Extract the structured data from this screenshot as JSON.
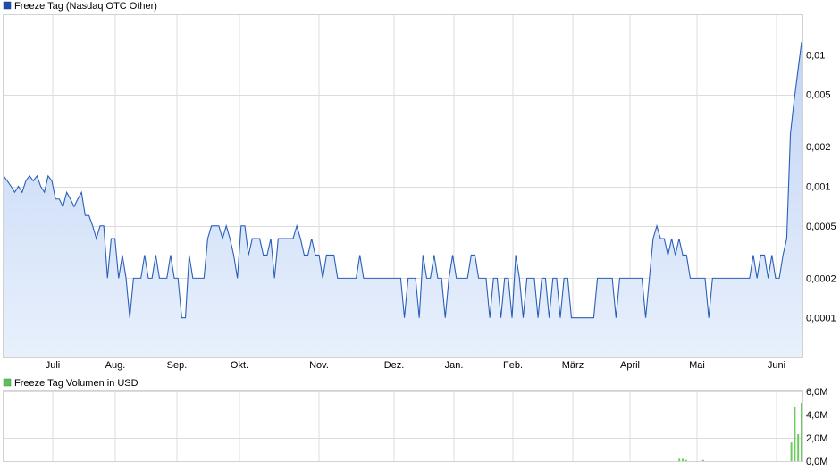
{
  "price_panel": {
    "legend": "Freeze Tag (Nasdaq OTC Other)",
    "legend_color": "#1f4ea8",
    "line_color": "#2a5fb8",
    "fill_top": "#c2d5f5",
    "fill_bottom": "#e8f0fc"
  },
  "volume_panel": {
    "legend": "Freeze Tag Volumen in USD",
    "legend_color": "#5bbf5b",
    "bar_color": "#6dcc5f"
  },
  "chart_data": [
    {
      "type": "area",
      "title": "Freeze Tag (Nasdaq OTC Other)",
      "y_scale": "log",
      "grid": true,
      "x_tick_labels": [
        "Juli",
        "Aug.",
        "Sep.",
        "Okt.",
        "Nov.",
        "Dez.",
        "Jan.",
        "Feb.",
        "März",
        "April",
        "Mai",
        "Juni"
      ],
      "y_ticks": [
        0.0001,
        0.0002,
        0.0005,
        0.001,
        0.002,
        0.005,
        0.01
      ],
      "y_tick_labels": [
        "0,0001",
        "0,0002",
        "0,0005",
        "0,001",
        "0,002",
        "0,005",
        "0,01"
      ],
      "ylim": [
        5e-05,
        0.02
      ],
      "series": [
        {
          "values": [
            0.0012,
            0.0011,
            0.001,
            0.0009,
            0.001,
            0.0009,
            0.0011,
            0.0012,
            0.0011,
            0.0012,
            0.001,
            0.0009,
            0.0012,
            0.0011,
            0.0008,
            0.0008,
            0.0007,
            0.0009,
            0.0008,
            0.0007,
            0.0008,
            0.0009,
            0.0006,
            0.0006,
            0.0005,
            0.0004,
            0.0005,
            0.0005,
            0.0002,
            0.0004,
            0.0004,
            0.0002,
            0.0003,
            0.0002,
            0.0001,
            0.0002,
            0.0002,
            0.0002,
            0.0003,
            0.0002,
            0.0002,
            0.0003,
            0.0002,
            0.0002,
            0.0002,
            0.0003,
            0.0002,
            0.0002,
            0.0001,
            0.0001,
            0.0003,
            0.0002,
            0.0002,
            0.0002,
            0.0002,
            0.0004,
            0.0005,
            0.0005,
            0.0005,
            0.0004,
            0.0005,
            0.0004,
            0.0003,
            0.0002,
            0.0005,
            0.0005,
            0.0003,
            0.0004,
            0.0004,
            0.0004,
            0.0003,
            0.0003,
            0.0004,
            0.0002,
            0.0004,
            0.0004,
            0.0004,
            0.0004,
            0.0004,
            0.0005,
            0.0004,
            0.0003,
            0.0003,
            0.0004,
            0.0003,
            0.0003,
            0.0002,
            0.0003,
            0.0003,
            0.0003,
            0.0002,
            0.0002,
            0.0002,
            0.0002,
            0.0002,
            0.0002,
            0.0003,
            0.0002,
            0.0002,
            0.0002,
            0.0002,
            0.0002,
            0.0002,
            0.0002,
            0.0002,
            0.0002,
            0.0002,
            0.0002,
            0.0001,
            0.0002,
            0.0002,
            0.0002,
            0.0001,
            0.0003,
            0.0002,
            0.0002,
            0.0003,
            0.0002,
            0.0002,
            0.0001,
            0.0002,
            0.0003,
            0.0002,
            0.0002,
            0.0002,
            0.0002,
            0.0003,
            0.0003,
            0.0002,
            0.0002,
            0.0002,
            0.0001,
            0.0002,
            0.0002,
            0.0001,
            0.0002,
            0.0002,
            0.0001,
            0.0003,
            0.0002,
            0.0001,
            0.0002,
            0.0002,
            0.0002,
            0.0001,
            0.0002,
            0.0002,
            0.0001,
            0.0002,
            0.0002,
            0.0001,
            0.0002,
            0.0002,
            0.0001,
            0.0001,
            0.0001,
            0.0001,
            0.0001,
            0.0001,
            0.0001,
            0.0002,
            0.0002,
            0.0002,
            0.0002,
            0.0002,
            0.0001,
            0.0002,
            0.0002,
            0.0002,
            0.0002,
            0.0002,
            0.0002,
            0.0002,
            0.0001,
            0.0002,
            0.0004,
            0.0005,
            0.0004,
            0.0004,
            0.0003,
            0.0004,
            0.0003,
            0.0004,
            0.0003,
            0.0003,
            0.0002,
            0.0002,
            0.0002,
            0.0002,
            0.0002,
            0.0001,
            0.0002,
            0.0002,
            0.0002,
            0.0002,
            0.0002,
            0.0002,
            0.0002,
            0.0002,
            0.0002,
            0.0002,
            0.0002,
            0.0003,
            0.0002,
            0.0003,
            0.0003,
            0.0002,
            0.0003,
            0.0002,
            0.0002,
            0.0003,
            0.0004,
            0.0025,
            0.0045,
            0.0075,
            0.0125
          ]
        }
      ]
    },
    {
      "type": "bar",
      "title": "Freeze Tag Volumen in USD",
      "y_ticks": [
        0,
        2000000,
        4000000,
        6000000
      ],
      "y_tick_labels": [
        "0,0M",
        "2,0M",
        "4,0M",
        "6,0M"
      ],
      "ylim": [
        0,
        6000000
      ],
      "grid": true,
      "series": [
        {
          "name": "Volumen in USD",
          "values": [
            0,
            0,
            0,
            0,
            0,
            0,
            0,
            0,
            0,
            0,
            0,
            0,
            0,
            0,
            0,
            0,
            0,
            0,
            0,
            0,
            0,
            0,
            0,
            0,
            0,
            0,
            0,
            0,
            0,
            0,
            0,
            0,
            0,
            0,
            0,
            0,
            0,
            0,
            0,
            0,
            0,
            0,
            0,
            0,
            0,
            0,
            0,
            0,
            0,
            0,
            0,
            0,
            0,
            0,
            0,
            0,
            0,
            0,
            0,
            0,
            0,
            0,
            0,
            0,
            0,
            0,
            0,
            0,
            0,
            0,
            0,
            0,
            0,
            0,
            0,
            0,
            0,
            0,
            0,
            0,
            0,
            0,
            0,
            0,
            0,
            0,
            0,
            0,
            0,
            0,
            0,
            0,
            0,
            0,
            0,
            0,
            0,
            0,
            0,
            0,
            0,
            0,
            0,
            0,
            0,
            0,
            0,
            0,
            0,
            0,
            0,
            0,
            0,
            0,
            0,
            0,
            0,
            0,
            0,
            0,
            0,
            0,
            0,
            0,
            0,
            0,
            0,
            0,
            0,
            0,
            0,
            0,
            0,
            0,
            0,
            0,
            0,
            0,
            0,
            0,
            0,
            0,
            0,
            0,
            0,
            0,
            0,
            0,
            0,
            0,
            0,
            0,
            0,
            0,
            0,
            0,
            0,
            0,
            0,
            0,
            0,
            0,
            0,
            0,
            0,
            0,
            0,
            0,
            0,
            0,
            0,
            0,
            0,
            0,
            0,
            0,
            0,
            0,
            0,
            0,
            0,
            0,
            0,
            0,
            0,
            0,
            0,
            0,
            0,
            0,
            0,
            0,
            0,
            0,
            0,
            0,
            0,
            0,
            0,
            200000,
            200000,
            100000,
            0,
            0,
            0,
            0,
            100000,
            0,
            0,
            0,
            0,
            0,
            0,
            0,
            0,
            0,
            0,
            0,
            0,
            0,
            0,
            0,
            0,
            0,
            0,
            0,
            0,
            0,
            0,
            0,
            0,
            0,
            1600000,
            4700000,
            2300000,
            5000000
          ]
        }
      ]
    }
  ]
}
